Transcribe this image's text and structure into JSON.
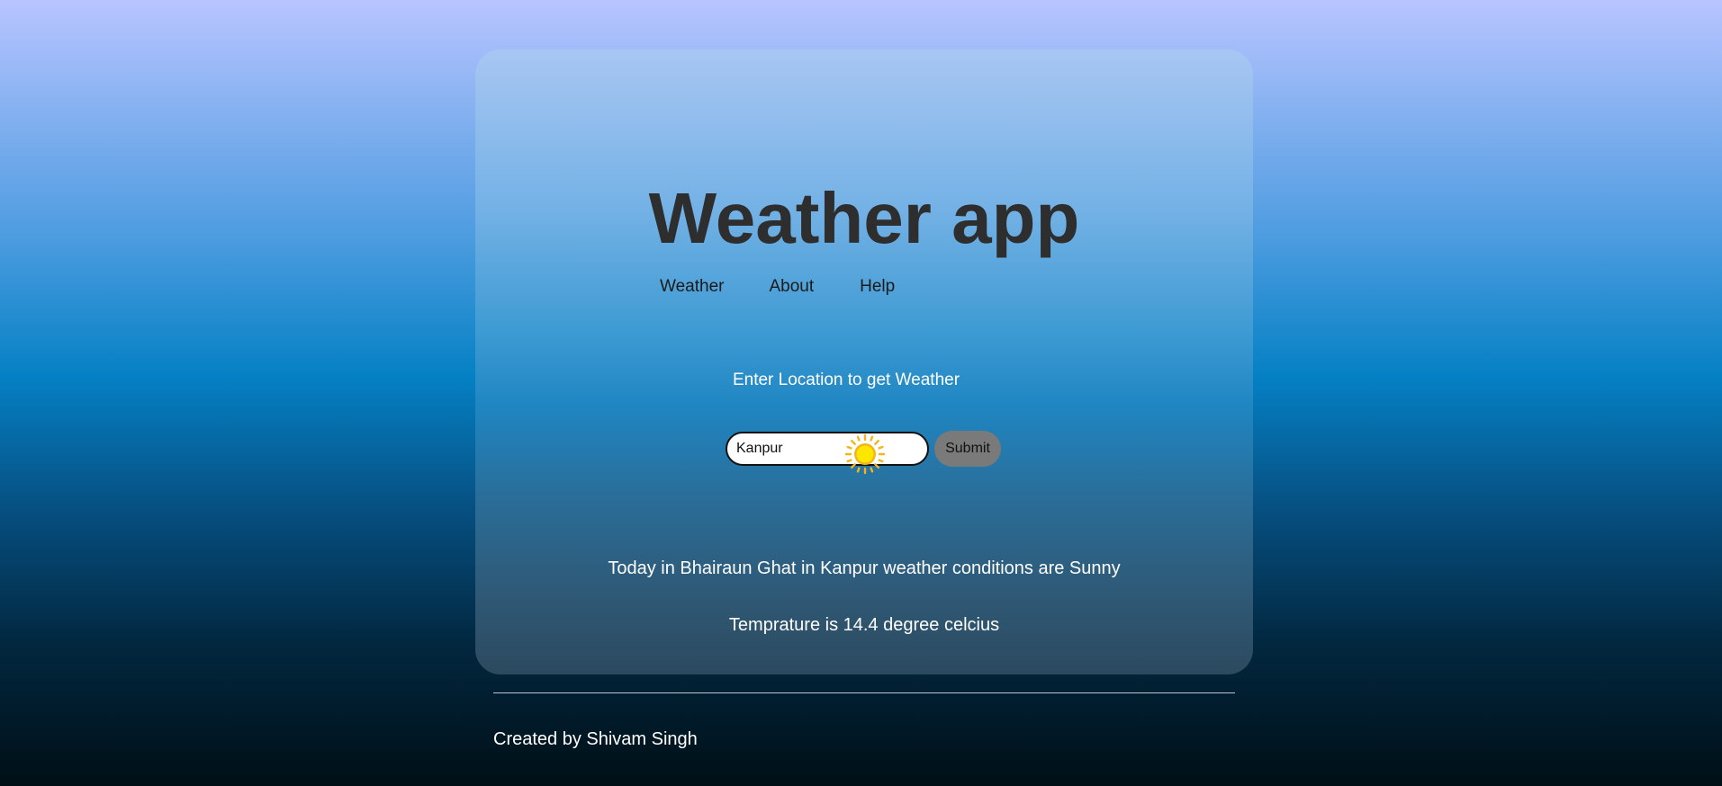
{
  "header": {
    "title": "Weather app"
  },
  "nav": {
    "items": [
      {
        "label": "Weather"
      },
      {
        "label": "About"
      },
      {
        "label": "Help"
      }
    ]
  },
  "main": {
    "prompt": "Enter Location to get Weather",
    "search": {
      "value": "Kanpur",
      "placeholder": "",
      "submit_label": "Submit"
    },
    "weather_icon": "sun-icon",
    "forecast": "Today in Bhairaun Ghat in Kanpur weather conditions are Sunny",
    "temperature": "Temprature is 14.4 degree celcius"
  },
  "footer": {
    "credit": "Created by Shivam Singh"
  },
  "colors": {
    "title": "#2e2e2e",
    "submit_bg": "#7a7a7a",
    "sun": "#ffd400"
  }
}
